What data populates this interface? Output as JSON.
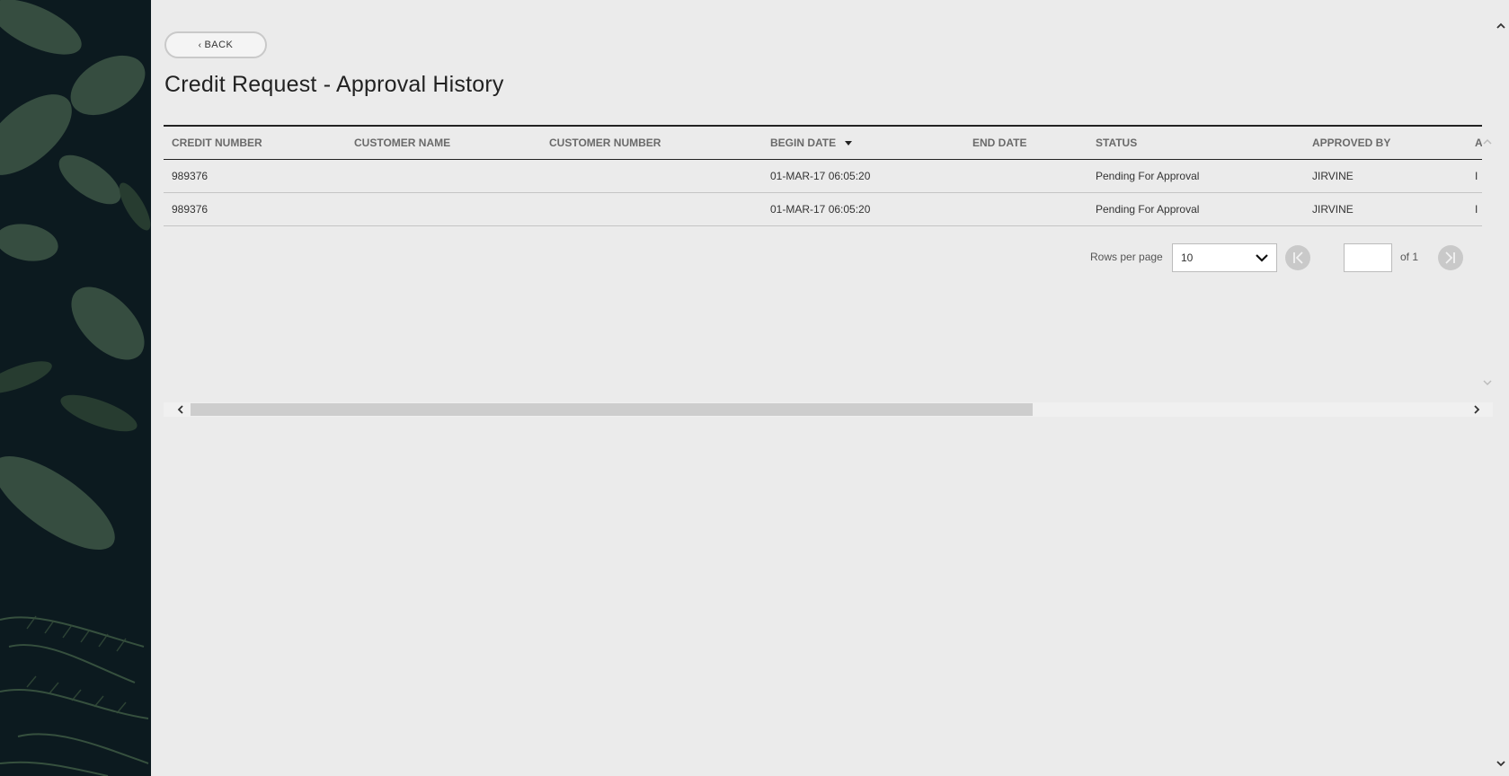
{
  "nav": {
    "back_label": "BACK"
  },
  "page": {
    "title": "Credit Request - Approval History"
  },
  "table": {
    "columns": [
      "CREDIT NUMBER",
      "CUSTOMER NAME",
      "CUSTOMER NUMBER",
      "BEGIN DATE",
      "END DATE",
      "STATUS",
      "APPROVED BY",
      "A"
    ],
    "sorted_column": "BEGIN DATE",
    "sort_direction": "descending",
    "rows": [
      [
        "989376",
        "",
        "",
        "01-MAR-17 06:05:20",
        "",
        "Pending For Approval",
        "JIRVINE",
        "I"
      ],
      [
        "989376",
        "",
        "",
        "01-MAR-17 06:05:20",
        "",
        "Pending For Approval",
        "JIRVINE",
        "I"
      ]
    ]
  },
  "pagination": {
    "rows_per_page_label": "Rows per page",
    "rows_per_page_value": "10",
    "current_page": "",
    "of_label": "of 1"
  },
  "icons": {
    "back": "chevron-left-icon",
    "sort": "sort-descending-icon",
    "first_page": "first-page-icon",
    "last_page": "last-page-icon",
    "dropdown": "chevron-down-icon"
  }
}
